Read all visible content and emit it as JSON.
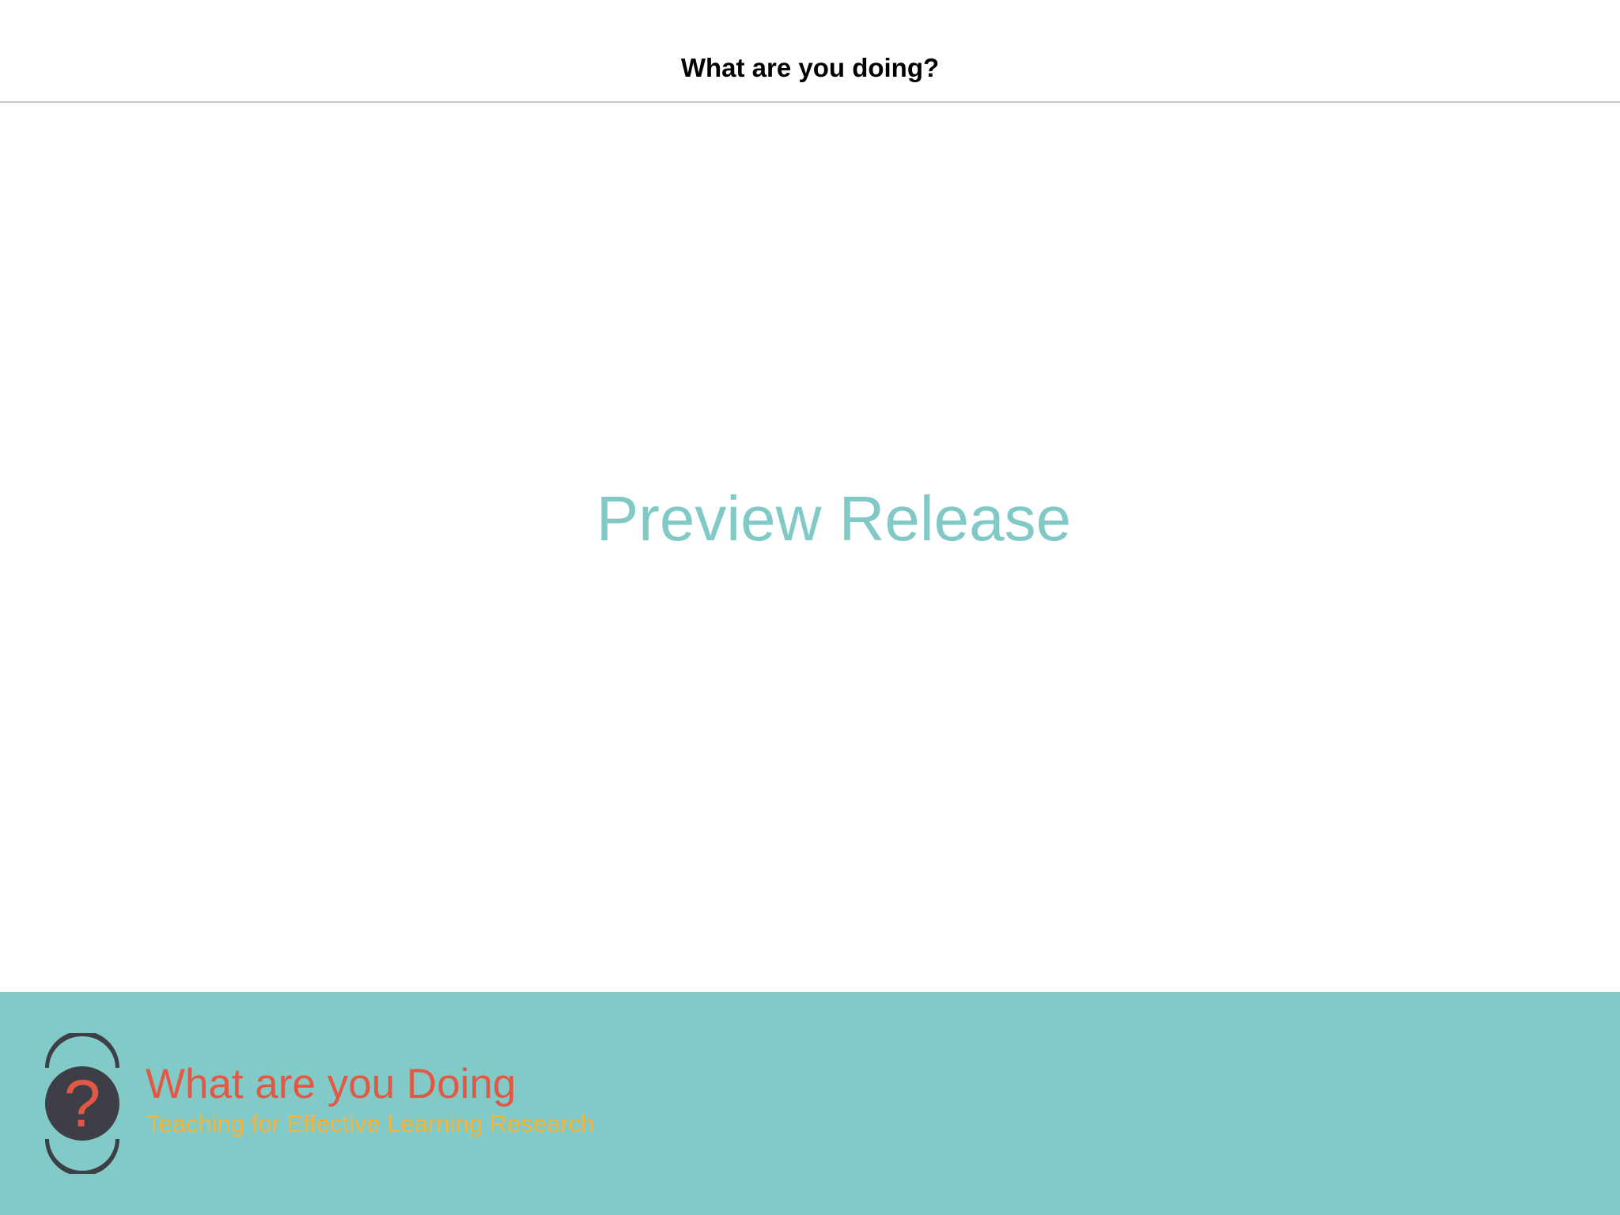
{
  "nav": {
    "title": "What are you doing?"
  },
  "main": {
    "preview_label": "Preview Release"
  },
  "footer": {
    "brand_title": "What are you Doing",
    "brand_subtitle": "Teaching for Effective Learning Research",
    "logo_icon": "question-mark-logo-icon"
  },
  "colors": {
    "teal": "#81cac7",
    "red": "#e15945",
    "yellow": "#f1b43d",
    "dark": "#3e3e47"
  }
}
